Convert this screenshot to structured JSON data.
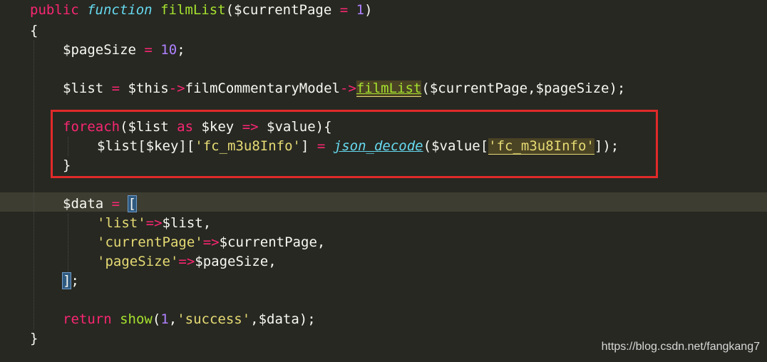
{
  "code": {
    "l1": {
      "t1": "public",
      "t2": " ",
      "t3": "function",
      "t4": " ",
      "t5": "filmList",
      "t6": "($currentPage ",
      "t7": "=",
      "t8": " ",
      "t9": "1",
      "t10": ")"
    },
    "l2": {
      "t1": "{"
    },
    "l3": {
      "t1": "$pageSize ",
      "t2": "=",
      "t3": " ",
      "t4": "10",
      "t5": ";"
    },
    "l4": {
      "t1": "$list ",
      "t2": "=",
      "t3": " $this",
      "t4": "->",
      "t5": "filmCommentaryModel",
      "t6": "->",
      "t7": "filmList",
      "t8": "($currentPage,$pageSize);"
    },
    "l5": {
      "t1": "foreach",
      "t2": "($list ",
      "t3": "as",
      "t4": " $key ",
      "t5": "=>",
      "t6": " $value){"
    },
    "l6": {
      "t1": "$list[$key][",
      "t2": "'fc_m3u8Info'",
      "t3": "] ",
      "t4": "=",
      "t5": " ",
      "t6": "json_decode",
      "t7": "($value[",
      "t8": "'fc_m3u8Info'",
      "t9": "]);"
    },
    "l7": {
      "t1": "}"
    },
    "l8": {
      "t1": "$data ",
      "t2": "=",
      "t3": " ",
      "t4": "["
    },
    "l9": {
      "t1": "'list'",
      "t2": "=>",
      "t3": "$list,"
    },
    "l10": {
      "t1": "'currentPage'",
      "t2": "=>",
      "t3": "$currentPage,"
    },
    "l11": {
      "t1": "'pageSize'",
      "t2": "=>",
      "t3": "$pageSize,"
    },
    "l12": {
      "t1": "]",
      "t2": ";"
    },
    "l13": {
      "t1": "return",
      "t2": " ",
      "t3": "show",
      "t4": "(",
      "t5": "1",
      "t6": ",",
      "t7": "'success'",
      "t8": ",$data);"
    },
    "l14": {
      "t1": "}"
    }
  },
  "watermark": "https://blog.csdn.net/fangkang7",
  "colors": {
    "background": "#272822",
    "keyword": "#f92672",
    "function": "#a6e22e",
    "number": "#ae81ff",
    "string": "#e6db74",
    "builtin": "#66d9ef",
    "highlight_box": "#e02a2a"
  }
}
